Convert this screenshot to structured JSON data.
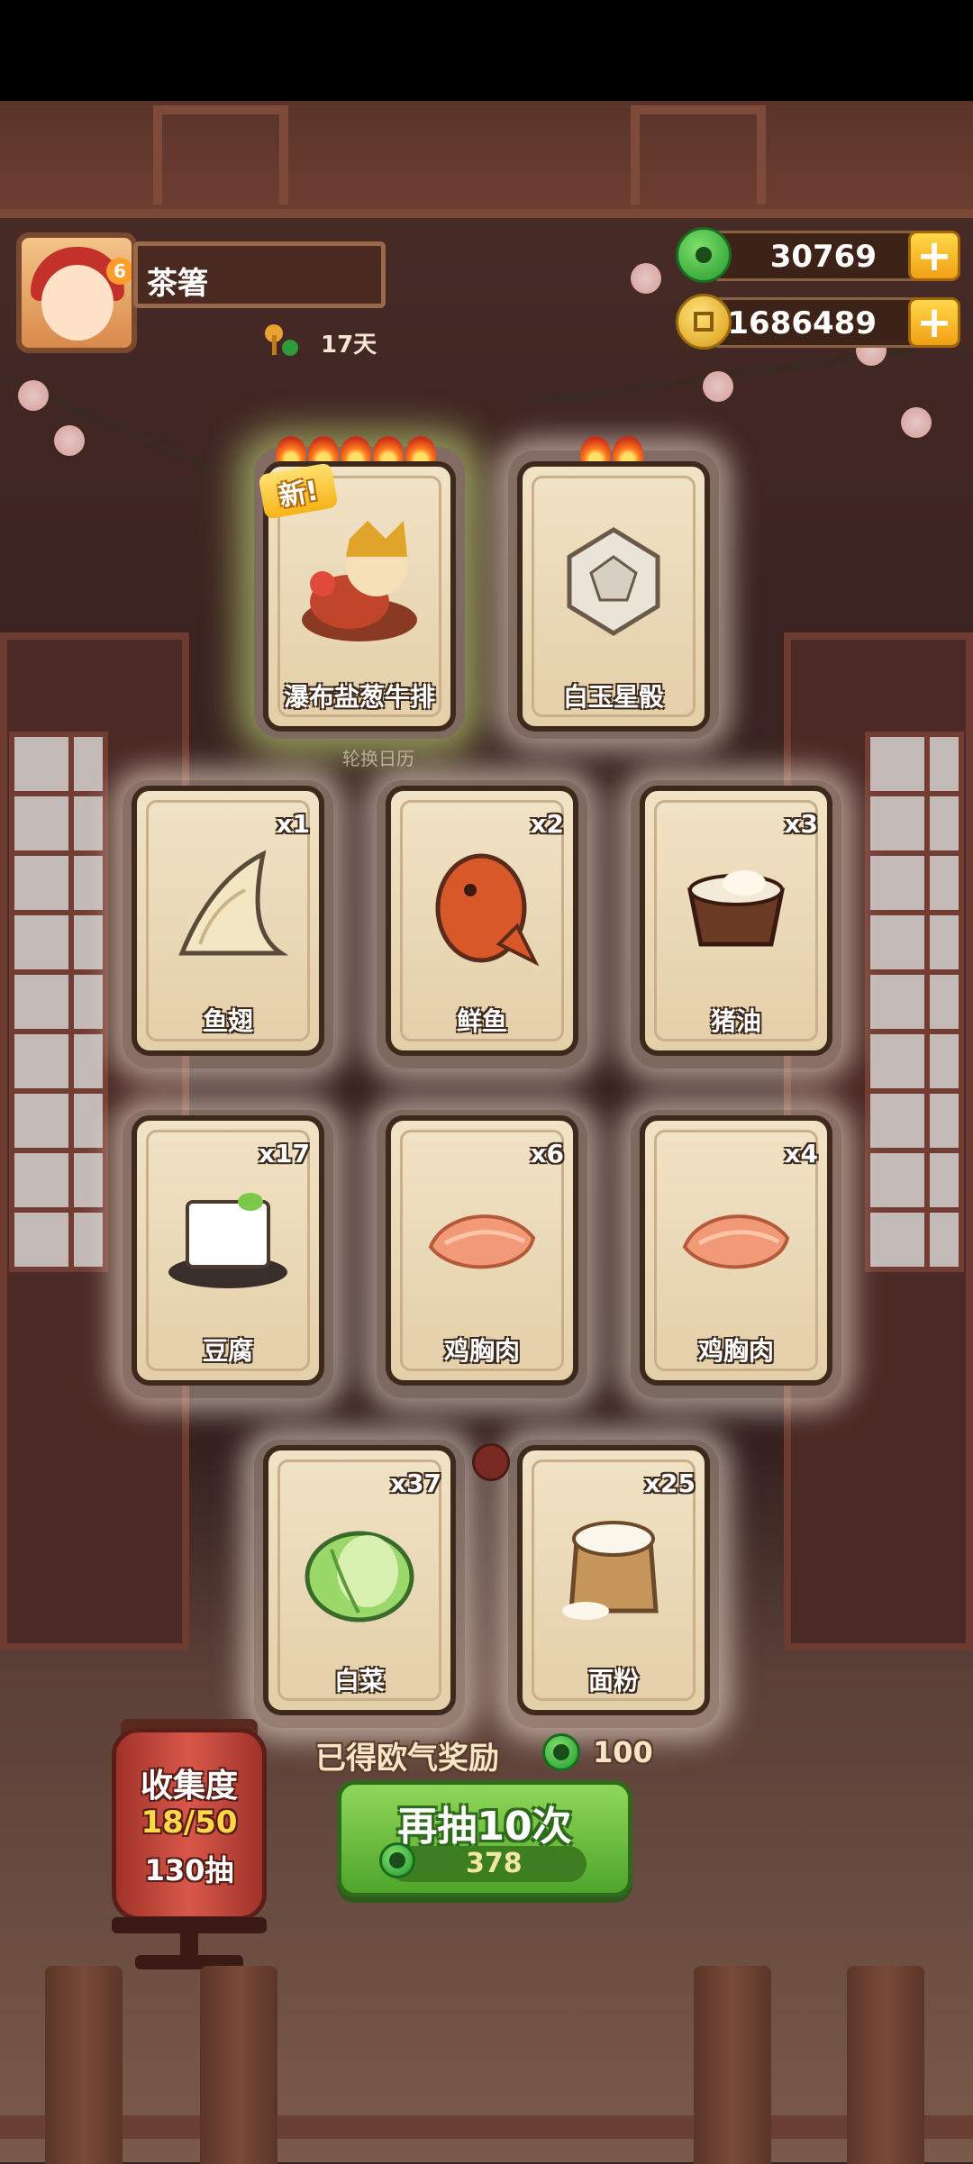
{
  "player": {
    "name": "茶箸",
    "days": "17天"
  },
  "currency": {
    "jade": {
      "value": "30769",
      "icon": "jade-icon"
    },
    "coins": {
      "value": "81686489",
      "icon": "coin-icon"
    },
    "plus_label": "+"
  },
  "featured_cards": [
    {
      "name": "瀑布盐葱牛排",
      "stars": 5,
      "is_new": true,
      "new_label": "新!"
    },
    {
      "name": "白玉星骰",
      "stars": 2
    }
  ],
  "cards": [
    {
      "name": "鱼翅",
      "qty": "x1"
    },
    {
      "name": "鲜鱼",
      "qty": "x2"
    },
    {
      "name": "猪油",
      "qty": "x3"
    },
    {
      "name": "豆腐",
      "qty": "x17"
    },
    {
      "name": "鸡胸肉",
      "qty": "x6"
    },
    {
      "name": "鸡胸肉",
      "qty": "x4"
    },
    {
      "name": "白菜",
      "qty": "x37"
    },
    {
      "name": "面粉",
      "qty": "x25"
    }
  ],
  "background_sign": "轮换日历",
  "luck_reward": {
    "label": "已得欧气奖励",
    "value": "100"
  },
  "draw_button": {
    "label": "再抽10次",
    "cost": "378"
  },
  "collection": {
    "title": "收集度",
    "progress": "18/50",
    "draws": "130抽"
  },
  "colors": {
    "accent_green": "#4ea52a",
    "card_bg": "#f1e3c6",
    "gold": "#ffd84a"
  }
}
